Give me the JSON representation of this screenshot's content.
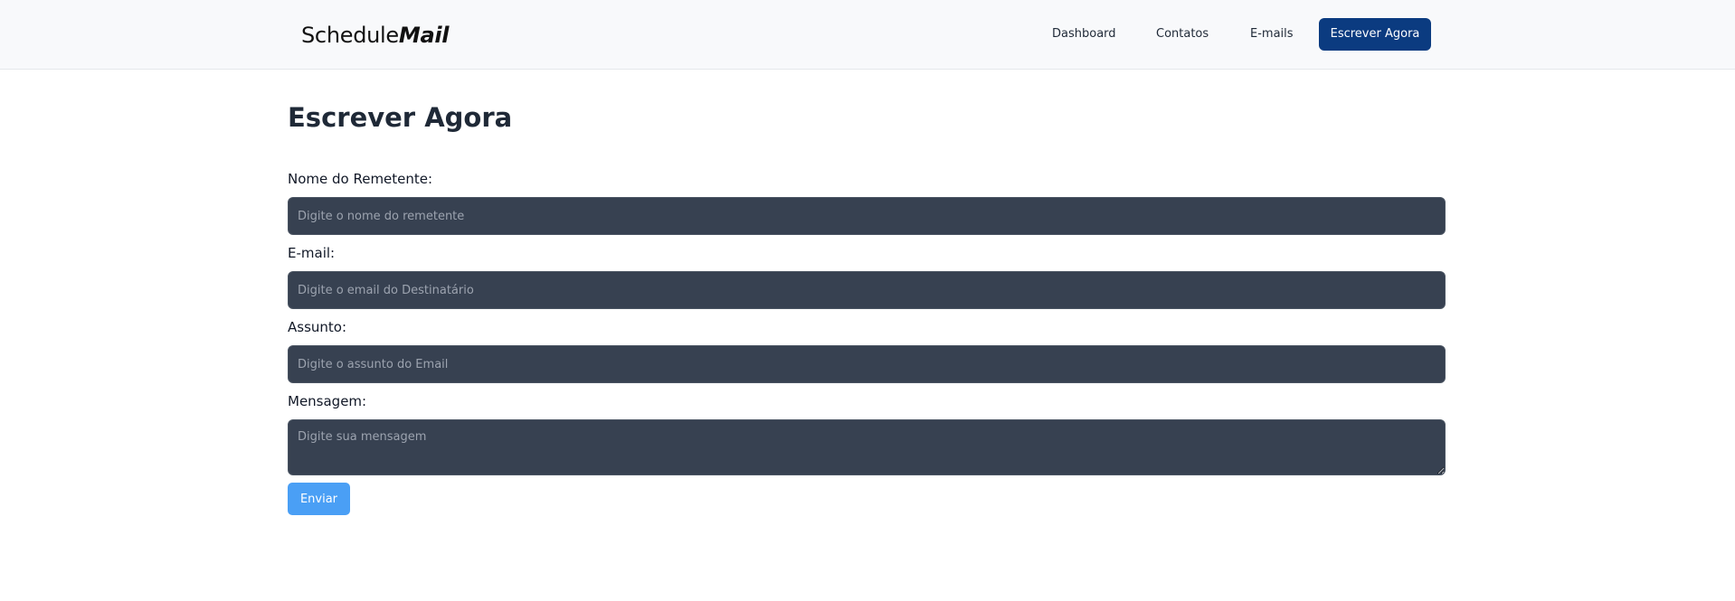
{
  "brand": {
    "name_regular": "Schedule",
    "name_strong": "Mail"
  },
  "nav": {
    "items": [
      {
        "label": "Dashboard"
      },
      {
        "label": "Contatos"
      },
      {
        "label": "E-mails"
      }
    ],
    "cta_label": "Escrever Agora"
  },
  "page": {
    "title": "Escrever Agora"
  },
  "form": {
    "sender": {
      "label": "Nome do Remetente:",
      "placeholder": "Digite o nome do remetente",
      "value": ""
    },
    "email": {
      "label": "E-mail:",
      "placeholder": "Digite o email do Destinatário",
      "value": ""
    },
    "subject": {
      "label": "Assunto:",
      "placeholder": "Digite o assunto do Email",
      "value": ""
    },
    "message": {
      "label": "Mensagem:",
      "placeholder": "Digite sua mensagem",
      "value": ""
    },
    "submit_label": "Enviar"
  },
  "colors": {
    "navbar_bg": "#f8f9fb",
    "cta_bg": "#0b3b80",
    "input_bg": "#374151",
    "submit_bg": "#4a9ff5"
  }
}
